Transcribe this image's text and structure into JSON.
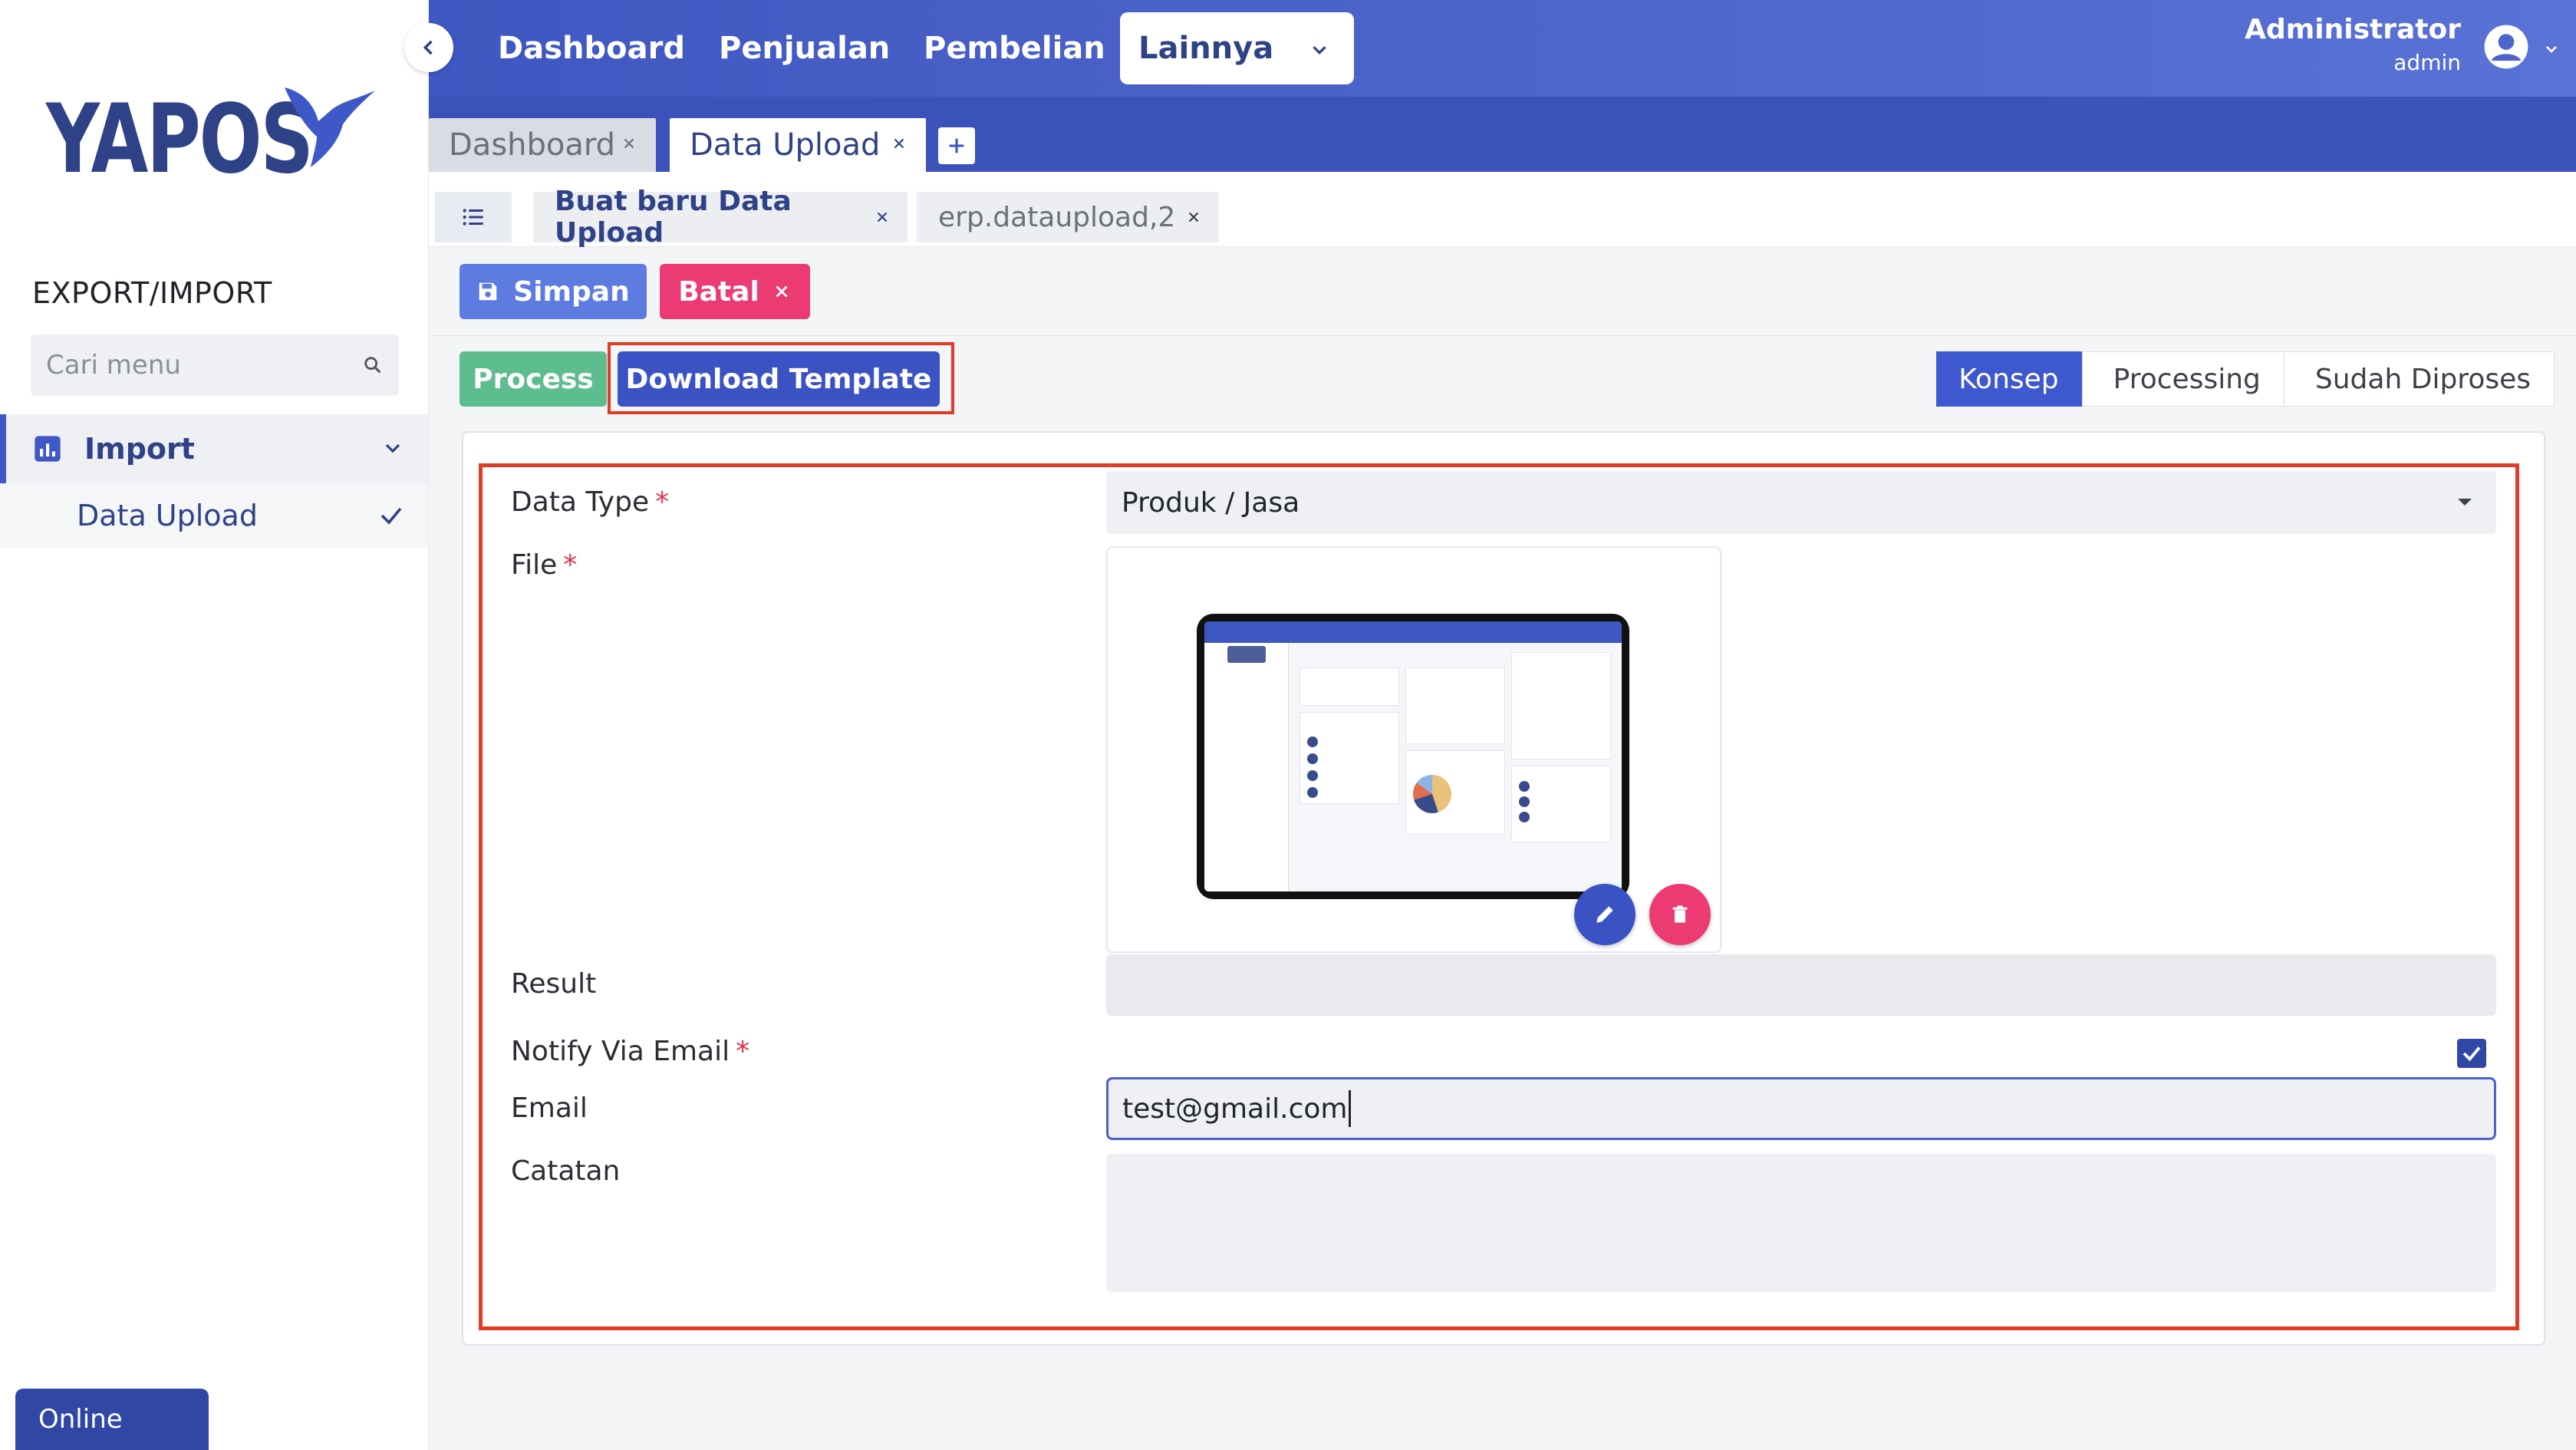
{
  "app": {
    "logo_text": "YAPOS",
    "section_title": "EXPORT/IMPORT",
    "status": "Online"
  },
  "sidebar": {
    "search_placeholder": "Cari menu",
    "menu": {
      "label": "Import",
      "sub_label": "Data Upload"
    }
  },
  "topnav": {
    "items": [
      "Dashboard",
      "Penjualan",
      "Pembelian"
    ],
    "more_label": "Lainnya",
    "user_name": "Administrator",
    "user_role": "admin"
  },
  "tabs": [
    {
      "label": "Dashboard"
    },
    {
      "label": "Data Upload"
    }
  ],
  "breadcrumbs": [
    {
      "label": "Buat baru Data Upload"
    },
    {
      "label": "erp.dataupload,2"
    }
  ],
  "actions": {
    "save_label": "Simpan",
    "cancel_label": "Batal",
    "process_label": "Process",
    "template_label": "Download Template"
  },
  "stages": [
    "Konsep",
    "Processing",
    "Sudah Diproses"
  ],
  "form": {
    "data_type_label": "Data Type",
    "data_type_value": "Produk / Jasa",
    "file_label": "File",
    "result_label": "Result",
    "notify_label": "Notify Via Email",
    "notify_checked": true,
    "email_label": "Email",
    "email_value": "test@gmail.com",
    "notes_label": "Catatan",
    "required_mark": "*"
  },
  "colors": {
    "primary": "#3f57c0",
    "accent_blue": "#3b52c4",
    "danger": "#ec3b73",
    "success": "#5dbd8e",
    "highlight": "#e03b24"
  }
}
